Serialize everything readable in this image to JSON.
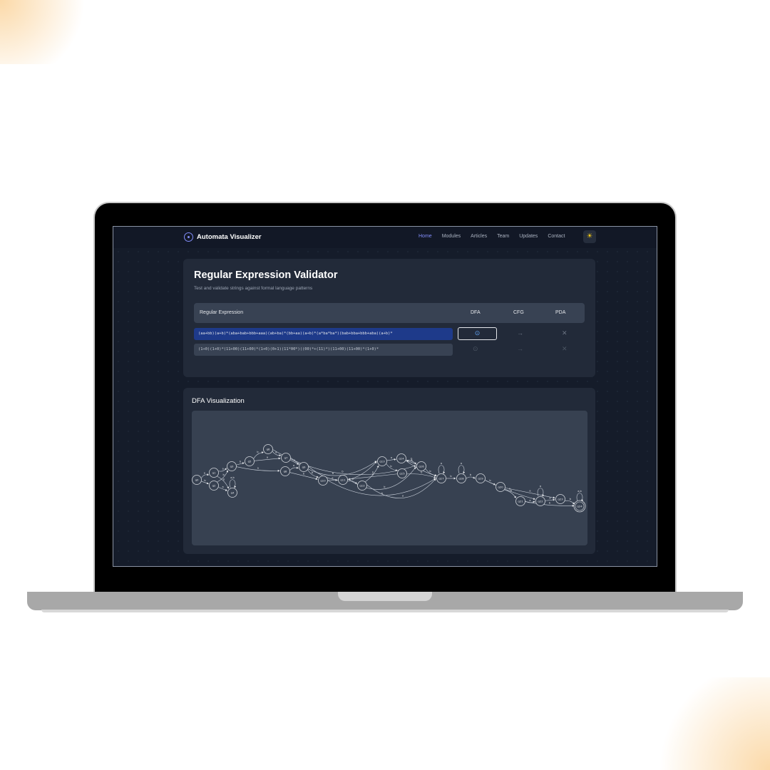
{
  "app": {
    "title": "Automata Visualizer"
  },
  "nav": {
    "links": [
      "Home",
      "Modules",
      "Articles",
      "Team",
      "Updates",
      "Contact"
    ],
    "active": "Home",
    "theme_icon": "sun-icon"
  },
  "validator": {
    "title": "Regular Expression Validator",
    "subtitle": "Test and validate strings against formal language patterns",
    "columns": [
      "Regular Expression",
      "DFA",
      "CFG",
      "PDA"
    ],
    "rows": [
      {
        "regex": "(aa+bb)(a+b)*(aba+bab+bbb+aaa)(ab+ba)*(bb+aa)(a+b)*(a*ba*ba*)(bab+bba+bbb+aba)(a+b)*",
        "selected": true
      },
      {
        "regex": "(1+0)(1+0)*(11+00)(11+00)*(1+0)(0+1)(11*00*)((00)*+(11)*)(11+00)(11+00)*(1+0)*",
        "selected": false
      }
    ],
    "icons": {
      "dfa": "⊙",
      "cfg": "→",
      "pda": "✕"
    }
  },
  "dfa": {
    "title": "DFA Visualization",
    "states": [
      "q0",
      "q1",
      "q2",
      "q3",
      "q4",
      "q5",
      "q6",
      "q7",
      "q8",
      "q9",
      "q10",
      "q11",
      "q12",
      "q13",
      "q14",
      "q15",
      "q16",
      "q17",
      "q18",
      "q19",
      "q20",
      "q21",
      "q22",
      "q23",
      "q24"
    ],
    "accepting": [
      "q24"
    ],
    "transitions": [
      [
        "q0",
        "q1",
        "a"
      ],
      [
        "q0",
        "q2",
        "b"
      ],
      [
        "q1",
        "q3",
        "a"
      ],
      [
        "q1",
        "q4",
        "b"
      ],
      [
        "q2",
        "q4",
        "a"
      ],
      [
        "q2",
        "q3",
        "b"
      ],
      [
        "q4",
        "q4",
        "a,b"
      ],
      [
        "q3",
        "q5",
        "b"
      ],
      [
        "q3",
        "q8",
        "a"
      ],
      [
        "q5",
        "q6",
        "b"
      ],
      [
        "q5",
        "q7",
        "a"
      ],
      [
        "q6",
        "q7",
        "a"
      ],
      [
        "q6",
        "q16",
        "b"
      ],
      [
        "q7",
        "q9",
        "a"
      ],
      [
        "q7",
        "q13",
        "b"
      ],
      [
        "q8",
        "q9",
        "a"
      ],
      [
        "q8",
        "q10",
        "b"
      ],
      [
        "q9",
        "q10",
        "b"
      ],
      [
        "q9",
        "q13",
        "a"
      ],
      [
        "q10",
        "q11",
        "a"
      ],
      [
        "q10",
        "q17",
        "b"
      ],
      [
        "q11",
        "q12",
        "a"
      ],
      [
        "q11",
        "q16",
        "b"
      ],
      [
        "q12",
        "q13",
        "b"
      ],
      [
        "q12",
        "q17",
        "a"
      ],
      [
        "q13",
        "q14",
        "a"
      ],
      [
        "q13",
        "q15",
        "b"
      ],
      [
        "q14",
        "q16",
        "b"
      ],
      [
        "q16",
        "q14",
        "a"
      ],
      [
        "q14",
        "q17",
        "a"
      ],
      [
        "q15",
        "q17",
        "b"
      ],
      [
        "q15",
        "q11",
        "a"
      ],
      [
        "q16",
        "q17",
        "b"
      ],
      [
        "q17",
        "q17",
        "a"
      ],
      [
        "q17",
        "q18",
        "b"
      ],
      [
        "q18",
        "q18",
        "a"
      ],
      [
        "q18",
        "q19",
        "b"
      ],
      [
        "q19",
        "q20",
        "b"
      ],
      [
        "q19",
        "q22",
        "a"
      ],
      [
        "q20",
        "q21",
        "b"
      ],
      [
        "q20",
        "q23",
        "a"
      ],
      [
        "q21",
        "q22",
        "a"
      ],
      [
        "q22",
        "q22",
        "a"
      ],
      [
        "q22",
        "q23",
        "a"
      ],
      [
        "q21",
        "q24",
        "b"
      ],
      [
        "q23",
        "q24",
        "b"
      ],
      [
        "q24",
        "q24",
        "a,b"
      ]
    ]
  }
}
